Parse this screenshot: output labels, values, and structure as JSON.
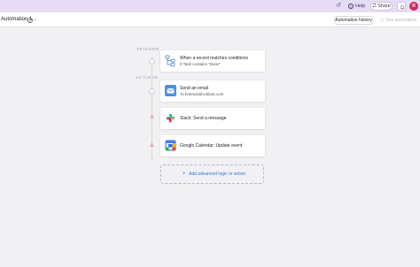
{
  "topbar": {
    "help_label": "Help",
    "share_label": "Share",
    "avatar_initial": "R"
  },
  "header": {
    "title": "Automation 1",
    "info_glyph": "i",
    "history_button": "Automation history",
    "test_button": "Test automation"
  },
  "sections": {
    "trigger": "TRIGGER",
    "actions": "ACTIONS"
  },
  "steps": [
    {
      "title": "When a record matches conditions",
      "subtitle": "If Task contains \"Done\"",
      "icon": "filter-icon"
    },
    {
      "title": "Send an email",
      "subtitle": "To bnbnuk@scbbok.com",
      "icon": "email-icon"
    },
    {
      "title": "Slack: Send a message",
      "subtitle": "",
      "icon": "slack-icon",
      "warning": true
    },
    {
      "title": "Google Calendar: Update event",
      "subtitle": "",
      "icon": "google-calendar-icon",
      "warning": true
    }
  ],
  "add_action": {
    "plus": "+",
    "label": "Add advanced logic or action"
  },
  "colors": {
    "topbar": "#e6dcf6",
    "accent_link": "#3b74d6",
    "warning": "#d83a52",
    "avatar": "#d2285a"
  }
}
